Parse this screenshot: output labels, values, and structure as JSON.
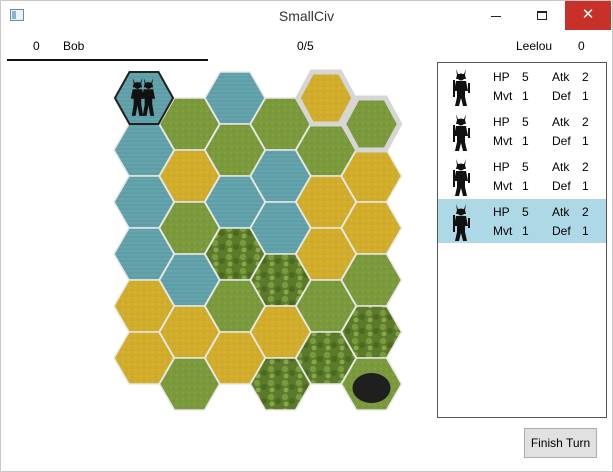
{
  "window": {
    "title": "SmallCiv"
  },
  "controls": {
    "minimize": "minimize",
    "maximize": "maximize",
    "close": "✕"
  },
  "score": {
    "player1": {
      "score": "0",
      "name": "Bob"
    },
    "turns": "0/5",
    "player2": {
      "name": "Leelou",
      "score": "0"
    }
  },
  "terrain_colors": {
    "water": "#5f9ea7",
    "plains": "#7b9a3c",
    "desert": "#d1ad2b",
    "forest": "#5b7a2a",
    "mountain": "#1f1f1f"
  },
  "map": {
    "columns": [
      [
        "water",
        "water",
        "water",
        "water",
        "desert",
        "desert"
      ],
      [
        "plains",
        "desert",
        "plains",
        "water",
        "desert",
        "plains"
      ],
      [
        "water",
        "plains",
        "water",
        "forest",
        "plains",
        "desert"
      ],
      [
        "plains",
        "water",
        "water",
        "forest",
        "desert",
        "forest"
      ],
      [
        "desert",
        "plains",
        "desert",
        "desert",
        "plains",
        "forest"
      ],
      [
        "plains",
        "desert",
        "desert",
        "plains",
        "forest",
        "mountain"
      ]
    ],
    "highlighted": [
      [
        4,
        0
      ],
      [
        5,
        0
      ]
    ]
  },
  "units": [
    {
      "hp_label": "HP",
      "hp": "5",
      "atk_label": "Atk",
      "atk": "2",
      "mvt_label": "Mvt",
      "mvt": "1",
      "def_label": "Def",
      "def": "1",
      "selected": false
    },
    {
      "hp_label": "HP",
      "hp": "5",
      "atk_label": "Atk",
      "atk": "2",
      "mvt_label": "Mvt",
      "mvt": "1",
      "def_label": "Def",
      "def": "1",
      "selected": false
    },
    {
      "hp_label": "HP",
      "hp": "5",
      "atk_label": "Atk",
      "atk": "2",
      "mvt_label": "Mvt",
      "mvt": "1",
      "def_label": "Def",
      "def": "1",
      "selected": false
    },
    {
      "hp_label": "HP",
      "hp": "5",
      "atk_label": "Atk",
      "atk": "2",
      "mvt_label": "Mvt",
      "mvt": "1",
      "def_label": "Def",
      "def": "1",
      "selected": true
    }
  ],
  "actions": {
    "finish_turn": "Finish Turn"
  },
  "selection_color": "#add8e6"
}
